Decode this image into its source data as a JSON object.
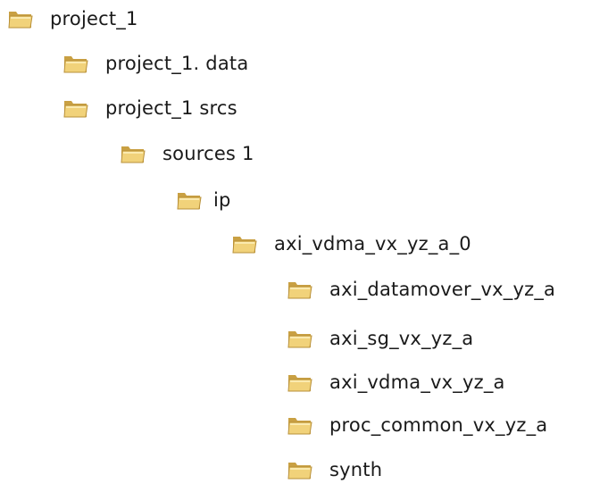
{
  "tree": {
    "items": [
      {
        "label": "project_1",
        "icon": "folder-icon",
        "depth": 0
      },
      {
        "label": "project_1. data",
        "icon": "folder-icon",
        "depth": 1
      },
      {
        "label": "project_1 srcs",
        "icon": "folder-icon",
        "depth": 1
      },
      {
        "label": "sources 1",
        "icon": "folder-icon",
        "depth": 2
      },
      {
        "label": "ip",
        "icon": "folder-icon",
        "depth": 3
      },
      {
        "label": "axi_vdma_vx_yz_a_0",
        "icon": "folder-icon",
        "depth": 4
      },
      {
        "label": "axi_datamover_vx_yz_a",
        "icon": "folder-icon",
        "depth": 5
      },
      {
        "label": "axi_sg_vx_yz_a",
        "icon": "folder-icon",
        "depth": 5
      },
      {
        "label": "axi_vdma_vx_yz_a",
        "icon": "folder-icon",
        "depth": 5
      },
      {
        "label": "proc_common_vx_yz_a",
        "icon": "folder-icon",
        "depth": 5
      },
      {
        "label": "synth",
        "icon": "folder-icon",
        "depth": 5
      }
    ]
  },
  "colors": {
    "folder_body": "#f1d27a",
    "folder_dark": "#c9a043",
    "folder_light": "#fbeaaf"
  }
}
